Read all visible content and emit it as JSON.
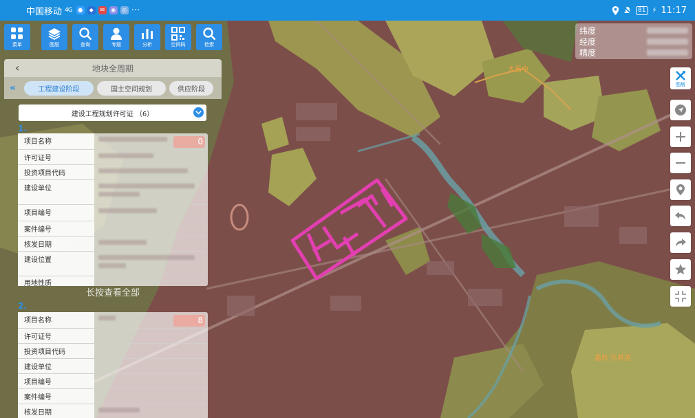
{
  "status_bar": {
    "carrier": "中国移动",
    "signal": "4G",
    "battery": "81",
    "time": "11:17",
    "more": "···"
  },
  "toolbar": [
    {
      "label": "菜单",
      "icon": "menu-grid-icon"
    },
    {
      "label": "图层",
      "icon": "layers-icon"
    },
    {
      "label": "查询",
      "icon": "search-icon"
    },
    {
      "label": "专题",
      "icon": "person-icon"
    },
    {
      "label": "分析",
      "icon": "bar-chart-icon"
    },
    {
      "label": "空间码",
      "icon": "qr-code-icon"
    },
    {
      "label": "检索",
      "icon": "search-icon"
    }
  ],
  "coords": {
    "lat_label": "纬度",
    "lng_label": "经度",
    "acc_label": "精度"
  },
  "map_controls": {
    "layer_label": "图层"
  },
  "map_labels": {
    "label_a": "大易中",
    "label_b": "嘉欣·东昇苑"
  },
  "panel": {
    "title": "地块全周期",
    "tabs": [
      "工程建设阶段",
      "国土空间规划",
      "供应阶段"
    ],
    "active_tab": 0,
    "dropdown": "建设工程规划许可证  （6）",
    "records": [
      {
        "num": "1.",
        "badge": "0",
        "fields": [
          "项目名称",
          "许可证号",
          "投资项目代码",
          "建设单位",
          "项目编号",
          "案件编号",
          "核发日期",
          "建设位置",
          "用地性质"
        ]
      },
      {
        "num": "2.",
        "badge": "8",
        "fields": [
          "项目名称",
          "许可证号",
          "投资项目代码",
          "建设单位",
          "项目编号",
          "案件编号",
          "核发日期"
        ]
      }
    ],
    "long_press": "长按查看全部"
  },
  "colors": {
    "accent": "#2d8ee6",
    "status_bar": "#1a8fe0",
    "boundary": "#e23fb0"
  }
}
